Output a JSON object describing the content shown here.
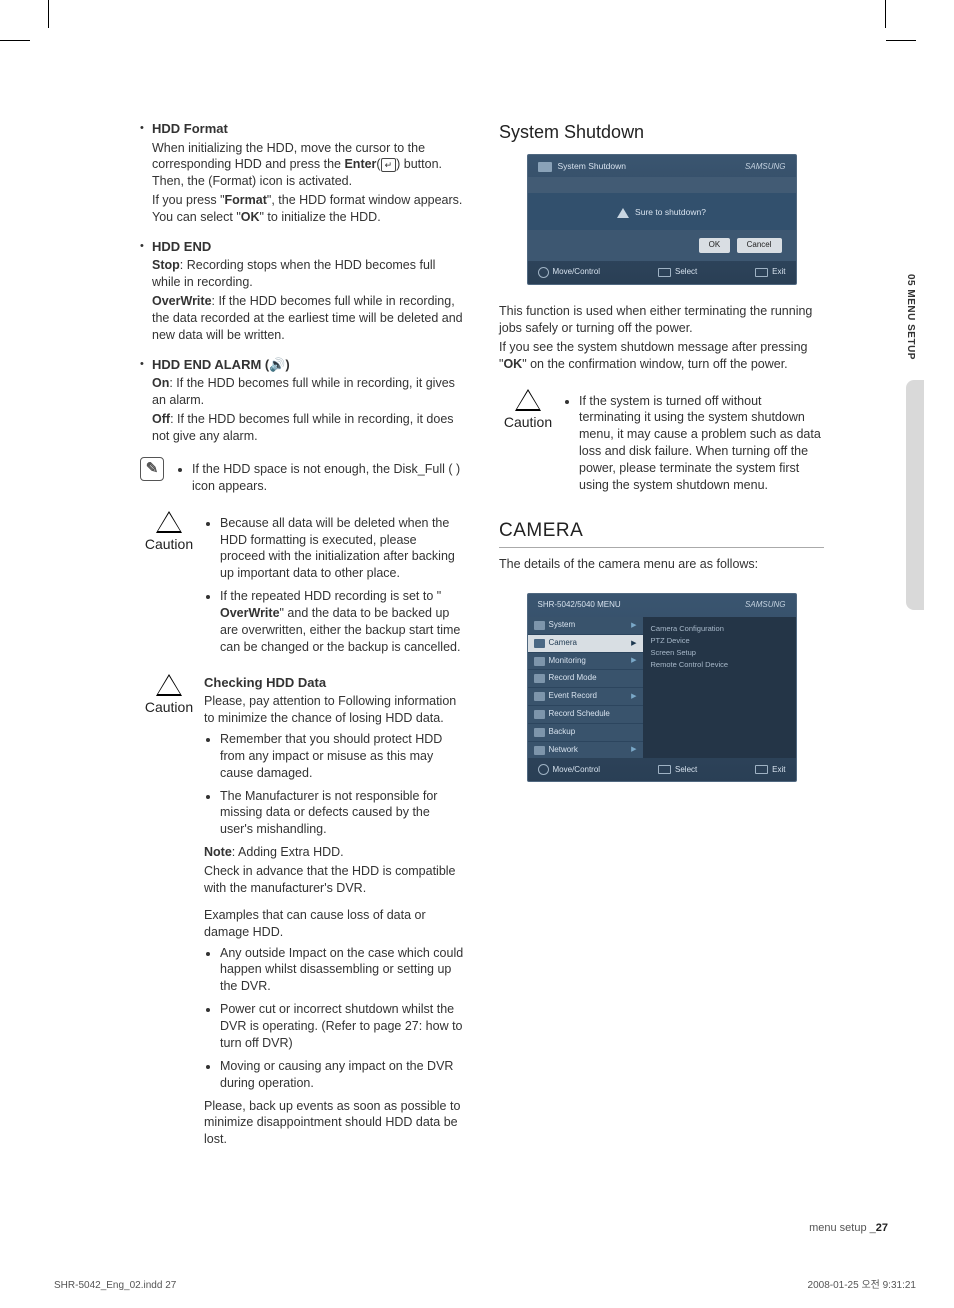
{
  "sideTab": "05 MENU SETUP",
  "left": {
    "hddFormat": {
      "title": "HDD Format",
      "p1a": "When initializing the HDD, move the cursor to the corresponding HDD and press the ",
      "p1b": "Enter",
      "p1c": "(",
      "p1d": ") button. Then, the (Format) icon is activated.",
      "p2a": "If you press \"",
      "p2b": "Format",
      "p2c": "\", the HDD format window appears. You can select \"",
      "p2d": "OK",
      "p2e": "\" to initialize the HDD."
    },
    "hddEnd": {
      "title": "HDD END",
      "stopLabel": "Stop",
      "stopText": ": Recording stops when the HDD becomes full while in recording.",
      "owLabel": "OverWrite",
      "owText": ": If the HDD becomes full while in recording, the data recorded at the earliest time will be deleted and new data will be written."
    },
    "hddAlarm": {
      "title": "HDD END ALARM (🔊)",
      "onLabel": "On",
      "onText": ": If the HDD becomes full while in recording, it gives an alarm.",
      "offLabel": "Off",
      "offText": ": If the HDD becomes full while in recording, it does not give any alarm."
    },
    "note1": "If the HDD space is not enough, the Disk_Full (    ) icon appears.",
    "caution1Label": "Caution",
    "caution1_items": [
      "Because all data will be deleted when the HDD formatting is executed, please proceed with the initialization after backing up important data to other place.",
      "If the repeated HDD recording is set to \"OverWrite\" and the data to be backed up are overwritten, either the backup start time can be changed or the backup is cancelled."
    ],
    "checking": {
      "label": "Caution",
      "title": "Checking HDD Data",
      "intro": "Please, pay attention to Following information to minimize the chance of losing HDD data.",
      "items": [
        "Remember that you should protect HDD from any impact or misuse as this may cause damaged.",
        "The Manufacturer is not responsible for missing data or defects caused by the user's mishandling."
      ],
      "noteLabel": "Note",
      "noteText": ": Adding Extra HDD.",
      "afterNote": "Check in advance that the HDD is compatible with the manufacturer's DVR.",
      "examples": "Examples that can cause loss of data or damage HDD.",
      "exItems": [
        "Any outside Impact on the case which could happen whilst  disassembling or setting up the DVR.",
        "Power cut or incorrect shutdown whilst the DVR is operating. (Refer to page 27: how to turn off DVR)",
        "Moving or causing any impact on the DVR during operation."
      ],
      "closing": "Please, back up events as soon as possible to minimize disappointment should HDD data be lost."
    }
  },
  "right": {
    "shutdown": {
      "heading": "System Shutdown",
      "uiTitle": "System Shutdown",
      "uiBrand": "SAMSUNG",
      "uiBody": "Sure to shutdown?",
      "okBtn": "OK",
      "cancelBtn": "Cancel",
      "moveControl": "Move/Control",
      "select": "Select",
      "exit": "Exit",
      "p1": "This function is used when either terminating the running jobs safely or turning off the power.",
      "p2a": "If you see the system shutdown message after pressing \"",
      "p2b": "OK",
      "p2c": "\" on the confirmation window, turn off the power.",
      "cautionLabel": "Caution",
      "cautionText": "If the system is turned off without terminating it using the system shutdown menu, it may cause a problem such as data loss and disk failure.  When turning off the power, please terminate the system first using the system shutdown menu."
    },
    "camera": {
      "heading": "CAMERA",
      "intro": "The details of the camera menu are as follows:",
      "uiTitle": "SHR-5042/5040 MENU",
      "uiBrand": "SAMSUNG",
      "leftItems": [
        "System",
        "Camera",
        "Monitoring",
        "Record Mode",
        "Event Record",
        "Record Schedule",
        "Backup",
        "Network"
      ],
      "rightItems": [
        "Camera Configuration",
        "PTZ Device",
        "Screen Setup",
        "Remote Control Device"
      ],
      "moveControl": "Move/Control",
      "select": "Select",
      "exit": "Exit"
    }
  },
  "footer": {
    "right": "menu setup _",
    "page": "27",
    "bottomLeft": "SHR-5042_Eng_02.indd   27",
    "bottomRight": "2008-01-25   오전 9:31:21"
  }
}
